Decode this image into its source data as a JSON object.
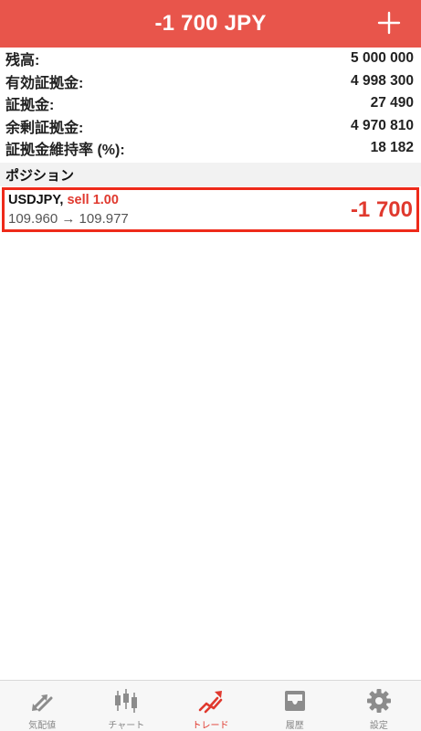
{
  "header": {
    "title": "-1 700 JPY",
    "add_label": "+"
  },
  "summary": {
    "rows": [
      {
        "label": "残高:",
        "value": "5 000 000"
      },
      {
        "label": "有効証拠金:",
        "value": "4 998 300"
      },
      {
        "label": "証拠金:",
        "value": "27 490"
      },
      {
        "label": "余剰証拠金:",
        "value": "4 970 810"
      },
      {
        "label": "証拠金維持率 (%):",
        "value": "18 182"
      }
    ]
  },
  "positions": {
    "section_title": "ポジション",
    "items": [
      {
        "symbol": "USDJPY,",
        "side_volume": "sell 1.00",
        "prices": "109.960 → 109.977",
        "profit": "-1 700"
      }
    ]
  },
  "tabbar": {
    "tabs": [
      {
        "label": "気配値",
        "icon": "quotes-arrows-icon",
        "active": false
      },
      {
        "label": "チャート",
        "icon": "candlestick-icon",
        "active": false
      },
      {
        "label": "トレード",
        "icon": "trade-trend-icon",
        "active": true
      },
      {
        "label": "履歴",
        "icon": "history-tray-icon",
        "active": false
      },
      {
        "label": "設定",
        "icon": "gear-icon",
        "active": false
      }
    ]
  },
  "colors": {
    "header_bg": "#e8554b",
    "accent_red": "#e0392e",
    "highlight_border": "#ee2a1a",
    "tab_inactive": "#888888"
  }
}
